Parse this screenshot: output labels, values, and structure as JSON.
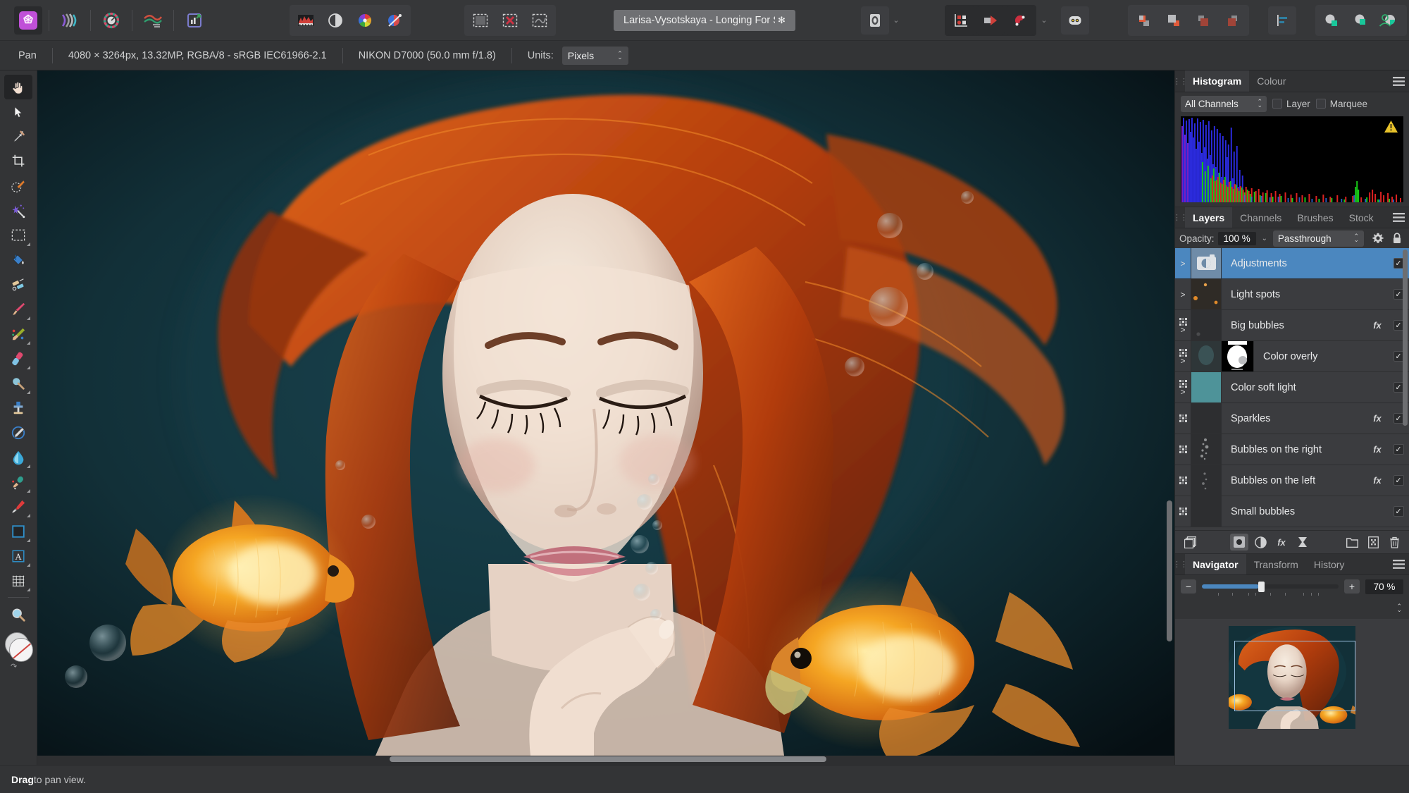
{
  "app": {
    "name": "Affinity Photo",
    "persona_icons": [
      "photo-persona-icon",
      "liquify-persona-icon",
      "develop-persona-icon",
      "tone-mapping-persona-icon",
      "export-persona-icon"
    ],
    "adjustment_icons": [
      "histogram-icon",
      "adjustment-icon",
      "colour-wheel-icon",
      "colour-picker-icon"
    ],
    "selection_icons": [
      "select-all-icon",
      "deselect-icon",
      "refine-selection-icon"
    ]
  },
  "document_tab": {
    "title": "Larisa-Vysotskaya - Longing For Silence (",
    "modified_marker": "✻"
  },
  "toolbar_right": {
    "view_mode_icon": "view-mode-icon",
    "view_mode_chevron": "chevron-down-icon",
    "snap_icons": [
      "snapping-grid-icon",
      "snapping-object-icon",
      "magnet-snap-icon"
    ],
    "snap_chevron": "chevron-down-icon",
    "assistant_icon": "assistant-robot-icon",
    "arrange_icons": [
      "bring-to-front-icon",
      "send-to-back-icon",
      "move-forward-icon",
      "move-backward-icon"
    ],
    "align_icon": "align-left-icon",
    "boolean_icons": [
      "add-geometry-icon",
      "subtract-geometry-icon",
      "intersect-geometry-icon"
    ],
    "account_icon": "user-account-icon"
  },
  "context_bar": {
    "tool_label": "Pan",
    "document_info": "4080 × 3264px, 13.32MP, RGBA/8 - sRGB IEC61966-2.1",
    "camera_info": "NIKON D7000 (50.0 mm f/1.8)",
    "units_label": "Units:",
    "units_value": "Pixels"
  },
  "tools": [
    {
      "name": "pan-tool",
      "icon": "hand-icon",
      "active": true,
      "has_flyout": false
    },
    {
      "name": "move-tool",
      "icon": "cursor-arrow-icon",
      "active": false,
      "has_flyout": false
    },
    {
      "name": "colour-picker-tool",
      "icon": "eyedropper-icon",
      "active": false,
      "has_flyout": false
    },
    {
      "name": "crop-tool",
      "icon": "crop-icon",
      "active": false,
      "has_flyout": false
    },
    {
      "name": "selection-brush-tool",
      "icon": "selection-brush-icon",
      "active": false,
      "has_flyout": false
    },
    {
      "name": "flood-select-tool",
      "icon": "magic-wand-icon",
      "active": false,
      "has_flyout": false
    },
    {
      "name": "marquee-tool",
      "icon": "marquee-rect-icon",
      "active": false,
      "has_flyout": true
    },
    {
      "name": "flood-fill-tool",
      "icon": "paint-bucket-icon",
      "active": false,
      "has_flyout": false
    },
    {
      "name": "paint-mixer-tool",
      "icon": "paint-mixer-icon",
      "active": false,
      "has_flyout": false
    },
    {
      "name": "paint-brush-tool",
      "icon": "paint-brush-icon",
      "active": false,
      "has_flyout": true
    },
    {
      "name": "colour-replacement-tool",
      "icon": "colour-replace-icon",
      "active": false,
      "has_flyout": true
    },
    {
      "name": "erase-brush-tool",
      "icon": "eraser-icon",
      "active": false,
      "has_flyout": true
    },
    {
      "name": "dodge-burn-tool",
      "icon": "dodge-burn-icon",
      "active": false,
      "has_flyout": true
    },
    {
      "name": "clone-brush-tool",
      "icon": "clone-stamp-icon",
      "active": false,
      "has_flyout": false
    },
    {
      "name": "healing-brush-tool",
      "icon": "healing-brush-icon",
      "active": false,
      "has_flyout": false
    },
    {
      "name": "blur-brush-tool",
      "icon": "blur-drop-icon",
      "active": false,
      "has_flyout": true
    },
    {
      "name": "smudge-brush-tool",
      "icon": "smudge-icon",
      "active": false,
      "has_flyout": true
    },
    {
      "name": "pen-tool",
      "icon": "pen-nib-icon",
      "active": false,
      "has_flyout": true
    },
    {
      "name": "rectangle-tool",
      "icon": "rectangle-shape-icon",
      "active": false,
      "has_flyout": true
    },
    {
      "name": "artistic-text-tool",
      "icon": "text-a-icon",
      "active": false,
      "has_flyout": true
    },
    {
      "name": "mesh-warp-tool",
      "icon": "mesh-grid-icon",
      "active": false,
      "has_flyout": true
    },
    {
      "name": "zoom-tool",
      "icon": "magnifier-icon",
      "active": false,
      "has_flyout": false
    }
  ],
  "histogram_panel": {
    "tabs": [
      {
        "label": "Histogram",
        "active": true
      },
      {
        "label": "Colour",
        "active": false
      }
    ],
    "menu_icon": "hamburger-menu-icon",
    "channel_select": "All Channels",
    "checkboxes": [
      {
        "label": "Layer",
        "checked": false
      },
      {
        "label": "Marquee",
        "checked": false
      }
    ],
    "clipping_warning_icon": "warning-triangle-icon"
  },
  "layers_panel": {
    "tabs": [
      {
        "label": "Layers",
        "active": true
      },
      {
        "label": "Channels",
        "active": false
      },
      {
        "label": "Brushes",
        "active": false
      },
      {
        "label": "Stock",
        "active": false
      }
    ],
    "menu_icon": "hamburger-menu-icon",
    "opacity_label": "Opacity:",
    "opacity_value": "100 %",
    "blend_mode": "Passthrough",
    "gear_icon": "gear-icon",
    "lock_icon": "lock-icon",
    "layers": [
      {
        "name": "Adjustments",
        "selected": true,
        "fx": "",
        "visible": true,
        "expandable": true,
        "masked": false,
        "thumb": "adjustment-thumb"
      },
      {
        "name": "Light spots",
        "selected": false,
        "fx": "",
        "visible": true,
        "expandable": true,
        "masked": false,
        "thumb": "light-spots-thumb"
      },
      {
        "name": "Big bubbles",
        "selected": false,
        "fx": "fx",
        "visible": true,
        "expandable": true,
        "masked": true,
        "thumb": "big-bubbles-thumb"
      },
      {
        "name": "Color overly",
        "selected": false,
        "fx": "",
        "visible": true,
        "expandable": true,
        "masked": true,
        "thumb": "color-overly-thumb",
        "mask_thumb": "color-overly-mask"
      },
      {
        "name": "Color soft light",
        "selected": false,
        "fx": "",
        "visible": true,
        "expandable": true,
        "masked": true,
        "thumb": "color-soft-light-thumb"
      },
      {
        "name": "Sparkles",
        "selected": false,
        "fx": "fx",
        "visible": true,
        "expandable": false,
        "masked": true,
        "thumb": "sparkles-thumb"
      },
      {
        "name": "Bubbles on the right",
        "selected": false,
        "fx": "fx",
        "visible": true,
        "expandable": false,
        "masked": true,
        "thumb": "bubbles-right-thumb"
      },
      {
        "name": "Bubbles on the left",
        "selected": false,
        "fx": "fx",
        "visible": true,
        "expandable": false,
        "masked": true,
        "thumb": "bubbles-left-thumb"
      },
      {
        "name": "Small bubbles",
        "selected": false,
        "fx": "",
        "visible": true,
        "expandable": false,
        "masked": true,
        "thumb": "small-bubbles-thumb"
      }
    ],
    "footer_icons": [
      "duplicate-layer-icon",
      "mask-layer-icon",
      "adjustment-layer-icon",
      "layer-effects-icon",
      "live-filter-icon",
      "add-group-icon",
      "add-pixel-layer-icon",
      "delete-layer-icon"
    ]
  },
  "navigator_panel": {
    "tabs": [
      {
        "label": "Navigator",
        "active": true
      },
      {
        "label": "Transform",
        "active": false
      },
      {
        "label": "History",
        "active": false
      }
    ],
    "menu_icon": "hamburger-menu-icon",
    "zoom_out_icon": "minus-icon",
    "zoom_in_icon": "plus-icon",
    "zoom_value": "70 %"
  },
  "status_bar": {
    "hint_strong": "Drag",
    "hint_rest": " to pan view."
  },
  "colors": {
    "app_bg": "#333436",
    "panel_bg": "#3b3c3f",
    "selection_blue": "#4b87bf",
    "accent_purple": "#c050d8",
    "warning_yellow": "#e8c22a",
    "canvas_dark": "#0c1d22",
    "text": "#e8e9ea"
  }
}
